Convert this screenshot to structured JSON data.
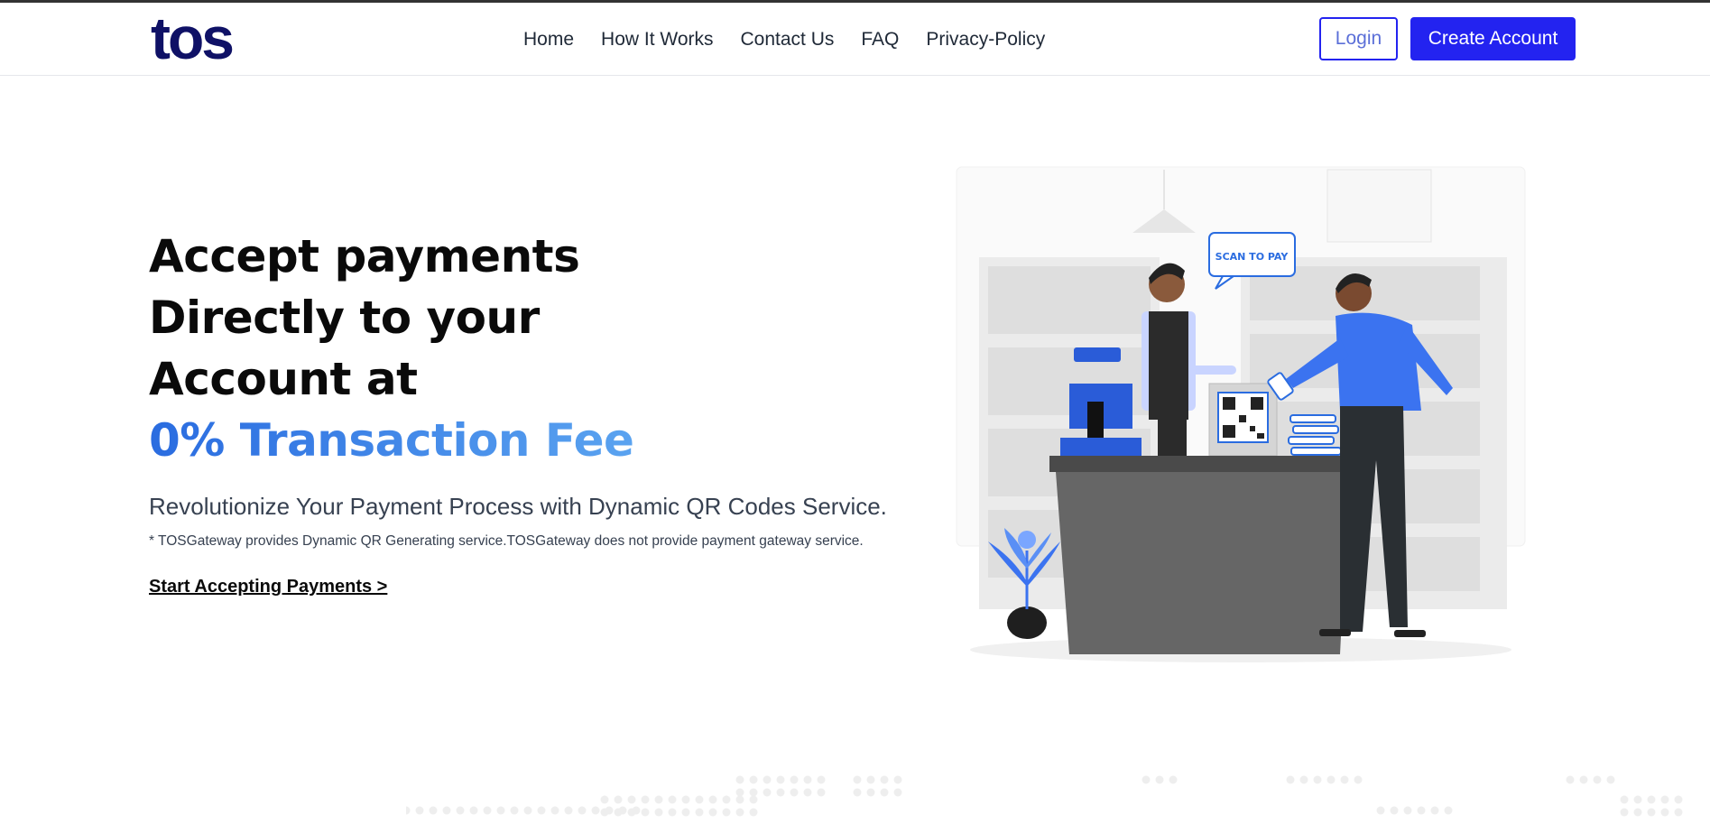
{
  "nav": {
    "logo": "tos",
    "links": [
      "Home",
      "How It Works",
      "Contact Us",
      "FAQ",
      "Privacy-Policy"
    ],
    "login_label": "Login",
    "create_account_label": "Create Account"
  },
  "hero": {
    "headline_line1": "Accept payments",
    "headline_line2": "Directly to your",
    "headline_line3": "Account at",
    "headline_accent": "0% Transaction Fee",
    "subtitle": "Revolutionize Your Payment Process with Dynamic QR Codes Service.",
    "note": "* TOSGateway provides Dynamic QR Generating service.TOSGateway does not provide payment gateway service.",
    "cta_label": "Start Accepting Payments >"
  },
  "illustration": {
    "speech_bubble": "SCAN TO PAY"
  },
  "colors": {
    "brand": "#2323f0",
    "logo": "#0f1166",
    "accent_start": "#2a6ce0",
    "accent_end": "#5aa3f0"
  }
}
